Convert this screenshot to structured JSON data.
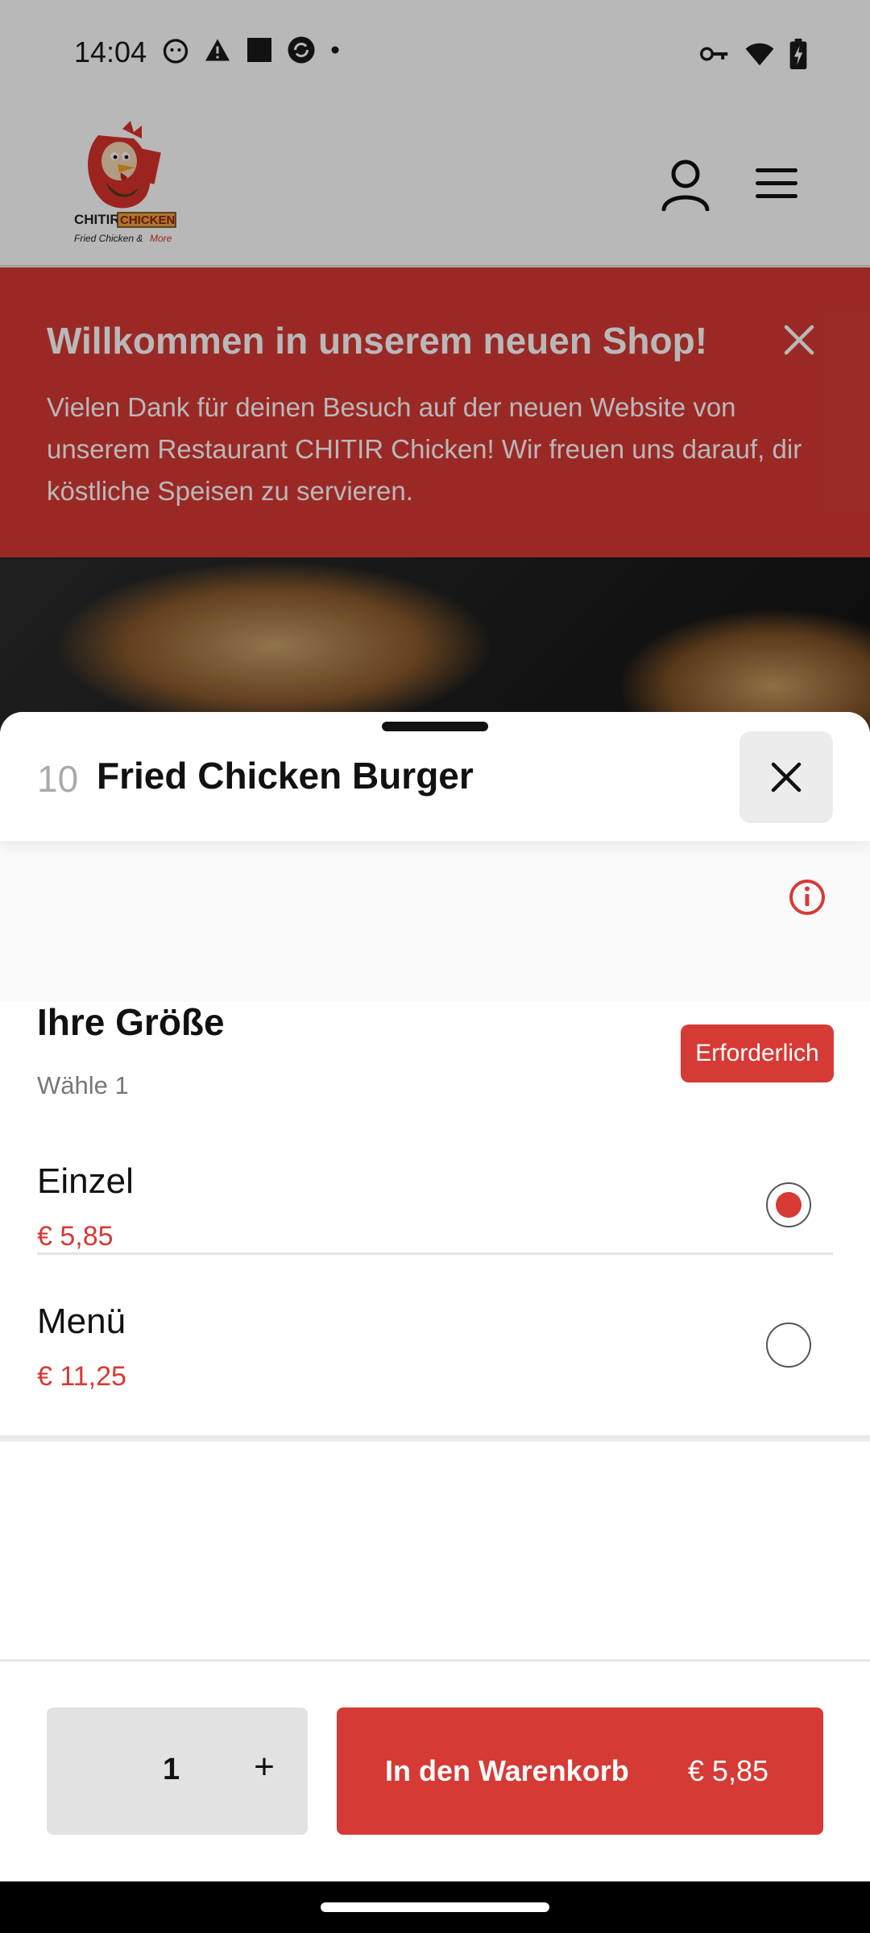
{
  "status_bar": {
    "time": "14:04",
    "left_icons": [
      "cat-app-icon",
      "warning-icon",
      "square-app-icon",
      "sync-app-icon",
      "dot-icon"
    ],
    "right_icons": [
      "vpn-key-icon",
      "wifi-icon",
      "battery-charging-icon"
    ]
  },
  "header": {
    "logo_name": "CHITIR CHICKEN",
    "logo_tagline": "Fried Chicken & More",
    "icons": [
      "user-icon",
      "menu-icon"
    ]
  },
  "banner": {
    "title": "Willkommen in unserem neuen Shop!",
    "text": "Vielen Dank für deinen Besuch auf der neuen Website von unserem Restaurant CHITIR Chicken! Wir freuen uns darauf, dir köstliche Speisen zu servieren."
  },
  "product_sheet": {
    "item_number": "10",
    "item_title": "Fried Chicken Burger",
    "group": {
      "title": "Ihre Größe",
      "subtitle": "Wähle 1",
      "required_label": "Erforderlich",
      "options": [
        {
          "name": "Einzel",
          "price": "€ 5,85",
          "selected": true
        },
        {
          "name": "Menü",
          "price": "€ 11,25",
          "selected": false
        }
      ]
    },
    "quantity": "1",
    "plus_label": "+",
    "add_to_cart_label": "In den Warenkorb",
    "add_to_cart_price": "€ 5,85"
  },
  "colors": {
    "accent": "#d63a35",
    "banner_bg": "#d63a35",
    "qty_bg": "#e2e2e2"
  }
}
